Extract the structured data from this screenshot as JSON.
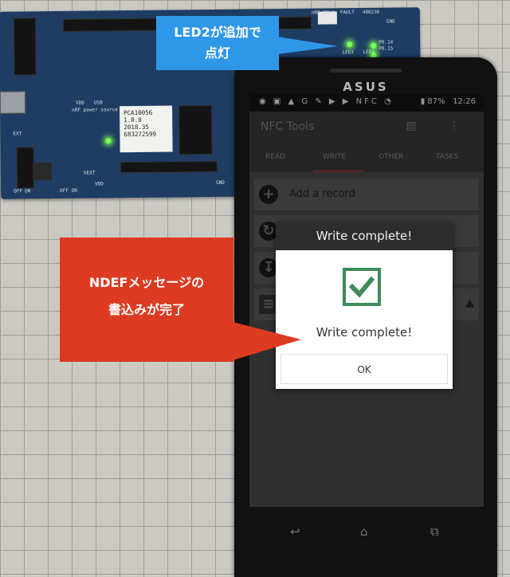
{
  "pcb": {
    "chip_label_lines": [
      "PCA10056",
      "1.0.0",
      "2018.35",
      "683272599"
    ],
    "silk_texts": [
      "VDD",
      "USB",
      "nRF power source",
      "VEXT",
      "VDD",
      "EXT",
      "OFF",
      "ON",
      "nRF ONLY",
      "FAULT",
      "400236",
      "GND",
      "GND",
      "LED3",
      "LED4",
      "P0.14",
      "P0.15",
      "OFF ON"
    ]
  },
  "phone": {
    "brand": "ASUS",
    "status_bar": {
      "left_icons": "◉ ▣ ▲ G ✎ ▶ ▶ NFC ◔",
      "battery": "87%",
      "time": "12:26"
    },
    "app_title": "NFC Tools",
    "appbar_icons": "▤ ⋮",
    "tabs": [
      "READ",
      "WRITE",
      "OTHER",
      "TASKS"
    ],
    "active_tab_index": 1,
    "rows": [
      {
        "icon": "plus-icon",
        "label": "Add a record"
      },
      {
        "icon": "refresh-icon",
        "label": ""
      },
      {
        "icon": "download-icon",
        "label": ""
      },
      {
        "icon": "menu-icon",
        "label": ""
      }
    ],
    "dialog": {
      "title": "Write complete!",
      "message": "Write complete!",
      "ok_label": "OK",
      "check_color": "#3d8b5a"
    },
    "nav": {
      "back": "↩",
      "home": "⌂",
      "recent": "⧉"
    }
  },
  "callouts": {
    "blue_line1": "LED2が追加で",
    "blue_line2": "点灯",
    "blue_color": "#2f97e8",
    "red_line1": "NDEFメッセージの",
    "red_line2": "書込みが完了",
    "red_color": "#dc3b22"
  }
}
